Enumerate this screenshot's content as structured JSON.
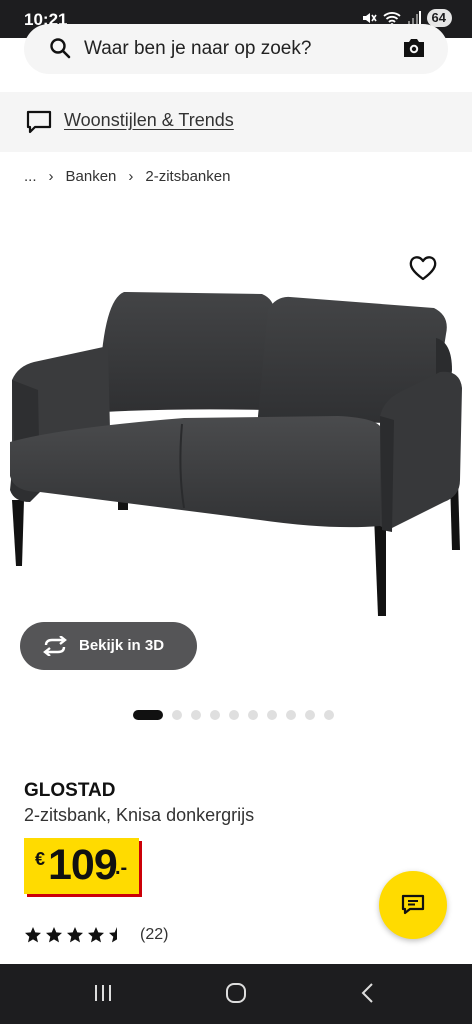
{
  "status_bar": {
    "time": "10:21",
    "battery": "64"
  },
  "search": {
    "placeholder": "Waar ben je naar op zoek?"
  },
  "styles_link": "Woonstijlen & Trends",
  "breadcrumb": {
    "ellipsis": "...",
    "items": [
      "Banken",
      "2-zitsbanken"
    ]
  },
  "view3d": {
    "label": "Bekijk in 3D"
  },
  "carousel": {
    "total": 10,
    "active": 1
  },
  "product": {
    "name": "GLOSTAD",
    "description": "2-zitsbank, Knisa donkergrijs",
    "price": {
      "currency": "€",
      "integer": "109",
      "decimal": ".-"
    },
    "rating": {
      "value": 4.5,
      "max": 5,
      "count": "(22)"
    }
  },
  "colors": {
    "accent": "#ffdb00",
    "price_shadow": "#cc0008",
    "dark": "#1d1d1f"
  },
  "icons": [
    "search-icon",
    "camera-icon",
    "chat-bubble-icon",
    "heart-icon",
    "rotate-3d-icon",
    "star-icon",
    "chat-fab-icon"
  ]
}
